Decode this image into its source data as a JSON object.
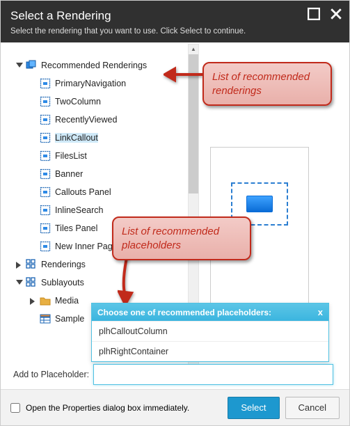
{
  "header": {
    "title": "Select a Rendering",
    "subtitle": "Select the rendering that you want to use. Click Select to continue."
  },
  "tree": {
    "recommended": {
      "label": "Recommended Renderings",
      "items": [
        "PrimaryNavigation",
        "TwoColumn",
        "RecentlyViewed",
        "LinkCallout",
        "FilesList",
        "Banner",
        "Callouts Panel",
        "InlineSearch",
        "Tiles Panel",
        "New Inner Page"
      ],
      "selected": "LinkCallout"
    },
    "renderings": {
      "label": "Renderings"
    },
    "sublayouts": {
      "label": "Sublayouts",
      "items": [
        {
          "label": "Media",
          "icon": "media"
        },
        {
          "label": "Sample",
          "icon": "sample"
        }
      ]
    }
  },
  "callouts": {
    "c1": "List of recommended renderings",
    "c2": "List of recommended placeholders"
  },
  "popup": {
    "title": "Choose one of recommended placeholders:",
    "items": [
      "plhCalloutColumn",
      "plhRightContainer"
    ]
  },
  "placeholder": {
    "label": "Add to Placeholder:",
    "value": ""
  },
  "footer": {
    "checkbox": "Open the Properties dialog box immediately.",
    "select": "Select",
    "cancel": "Cancel"
  }
}
